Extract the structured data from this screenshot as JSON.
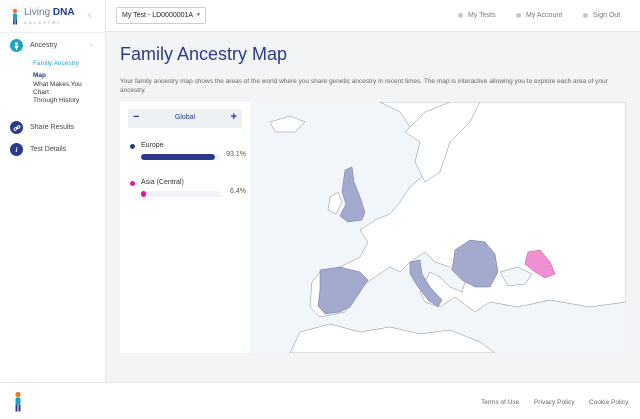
{
  "brand": {
    "name_light": "Living",
    "name_bold": "DNA",
    "subtitle": "ANCESTRY",
    "collapse_icon": "chevron-left-icon"
  },
  "sidebar": {
    "items": [
      {
        "label": "Ancestry",
        "icon": "person-icon"
      },
      {
        "label": "Share Results",
        "icon": "link-icon"
      },
      {
        "label": "Test Details",
        "icon": "info-icon"
      }
    ],
    "ancestry_sub": {
      "active": "Family Ancestry",
      "links": [
        "Map",
        "What Makes You",
        "Chart",
        "Through History"
      ]
    }
  },
  "header": {
    "test_select": "My Test - LD0000001A",
    "nav": [
      "My Tests",
      "My Account",
      "Sign Out"
    ]
  },
  "main": {
    "title": "Family Ancestry Map",
    "intro": "Your family ancestry map shows the areas of the world where you share genetic ancestry in recent times. The map is interactive allowing you to explore each area of your ancestry.",
    "region": {
      "label": "Global",
      "minus": "−",
      "plus": "+"
    },
    "populations": [
      {
        "name": "Europe",
        "percent": "93.1%",
        "value": 93.1,
        "color": "#2b3a8c"
      },
      {
        "name": "Asia (Central)",
        "percent": "6.4%",
        "value": 6.4,
        "color": "#e5199a"
      }
    ]
  },
  "colors": {
    "accent": "#1aa5c7",
    "navy": "#2b3a8c",
    "europe_map": "#a3aacd",
    "asia_map": "#f08fd2"
  },
  "footer": {
    "links": [
      "Terms of Use",
      "Privacy Policy",
      "Cookie Policy"
    ]
  }
}
